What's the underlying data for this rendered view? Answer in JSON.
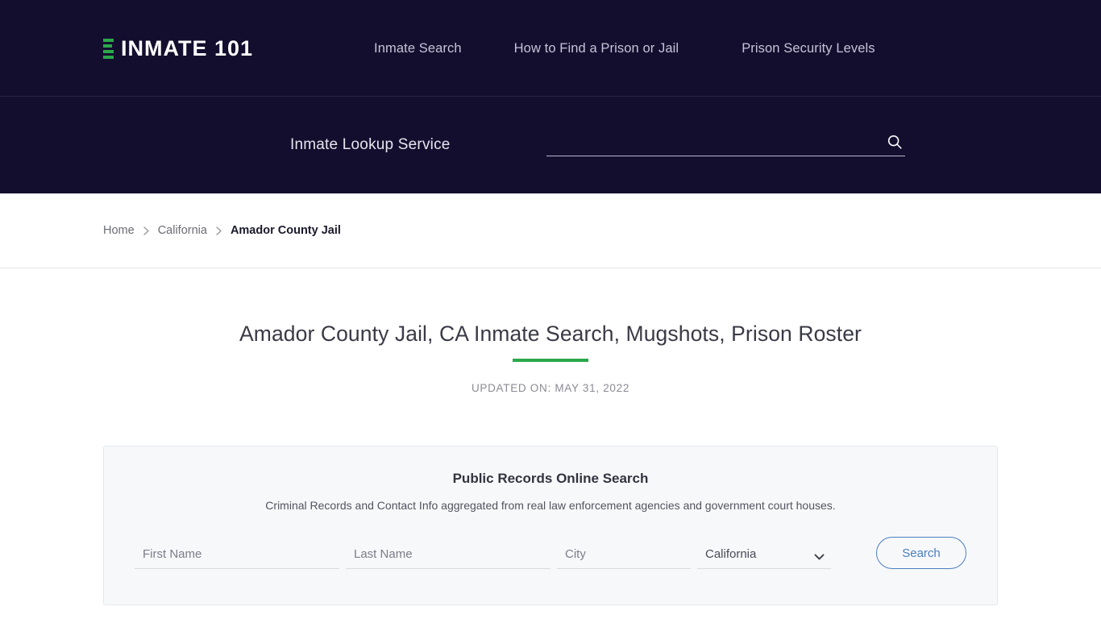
{
  "brand": {
    "name": "INMATE 101",
    "logo_icon": "stacked-bars-icon",
    "accent_green": "#2ba84a"
  },
  "header": {
    "background": "#140e2e",
    "nav": [
      {
        "label": "Inmate Search"
      },
      {
        "label": "How to Find a Prison or Jail"
      },
      {
        "label": "Prison Security Levels"
      }
    ]
  },
  "lookup": {
    "label": "Inmate Lookup Service",
    "search_value": "",
    "search_placeholder": "",
    "search_icon": "magnifier-icon"
  },
  "breadcrumb": {
    "items": [
      {
        "label": "Home",
        "current": false
      },
      {
        "label": "California",
        "current": false
      },
      {
        "label": "Amador County Jail",
        "current": true
      }
    ],
    "separator_icon": "chevron-right-icon"
  },
  "page": {
    "title": "Amador County Jail, CA Inmate Search, Mugshots, Prison Roster",
    "updated": "UPDATED ON: MAY 31, 2022"
  },
  "records_card": {
    "title": "Public Records Online Search",
    "subtitle": "Criminal Records and Contact Info aggregated from real law enforcement agencies and government court houses.",
    "fields": {
      "first_name": {
        "value": "",
        "placeholder": "First Name"
      },
      "last_name": {
        "value": "",
        "placeholder": "Last Name"
      },
      "city": {
        "value": "",
        "placeholder": "City"
      },
      "state": {
        "selected": "California",
        "options": [
          "California"
        ],
        "chevron_icon": "chevron-down-icon"
      }
    },
    "search_button": "Search",
    "button_color": "#4a7fc1"
  }
}
